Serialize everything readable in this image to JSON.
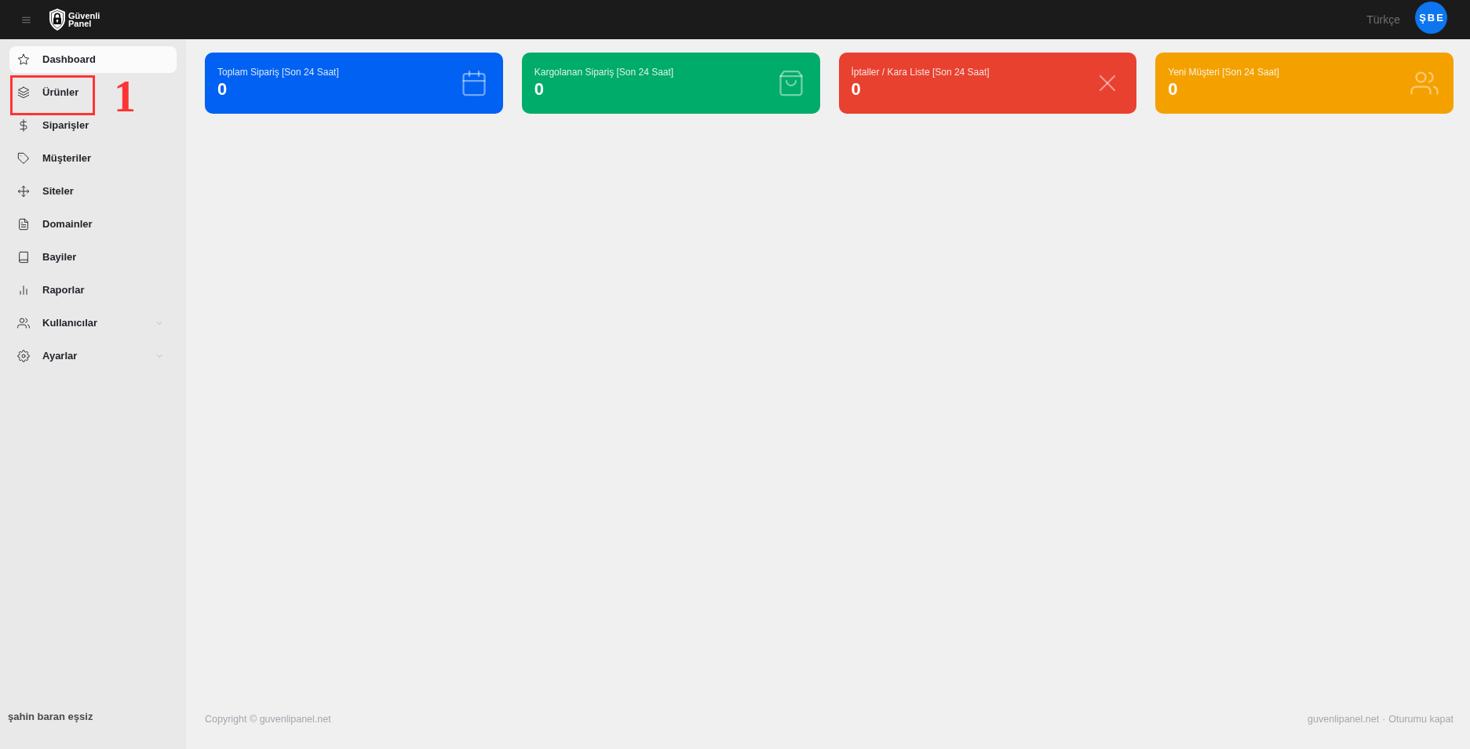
{
  "top_bar": {
    "logo": {
      "line_1": "Güvenli",
      "line_2": "Panel"
    },
    "language": "Türkçe",
    "avatar_initials": "ŞBE"
  },
  "sidebar": {
    "items": [
      {
        "label": "Dashboard",
        "kind": "link",
        "selected": true
      },
      {
        "label": "Ürünler",
        "kind": "link",
        "selected": false,
        "annotation": "1"
      },
      {
        "label": "Siparişler",
        "kind": "link",
        "selected": false
      },
      {
        "label": "Müşteriler",
        "kind": "link",
        "selected": false
      },
      {
        "label": "Siteler",
        "kind": "link",
        "selected": false
      },
      {
        "label": "Domainler",
        "kind": "link",
        "selected": false
      },
      {
        "label": "Bayiler",
        "kind": "link",
        "selected": false
      },
      {
        "label": "Raporlar",
        "kind": "link",
        "selected": false
      },
      {
        "label": "Kullanıcılar",
        "kind": "group",
        "selected": false
      },
      {
        "label": "Ayarlar",
        "kind": "group",
        "selected": false
      }
    ],
    "user_name": "şahin baran eşsiz"
  },
  "stat_cards": [
    {
      "title": "Toplam Sipariş [Son 24 Saat]",
      "value": "0",
      "color": "#0061f2"
    },
    {
      "title": "Kargolanan Sipariş [Son 24 Saat]",
      "value": "0",
      "color": "#00ac69"
    },
    {
      "title": "İptaller / Kara Liste [Son 24 Saat]",
      "value": "0",
      "color": "#e8412f"
    },
    {
      "title": "Yeni Müşteri [Son 24 Saat]",
      "value": "0",
      "color": "#f4a100"
    }
  ],
  "footer": {
    "copyright": "Copyright © guvenlipanel.net",
    "links": [
      "guvenlipanel.net",
      "Oturumu kapat"
    ],
    "separator": "·"
  }
}
